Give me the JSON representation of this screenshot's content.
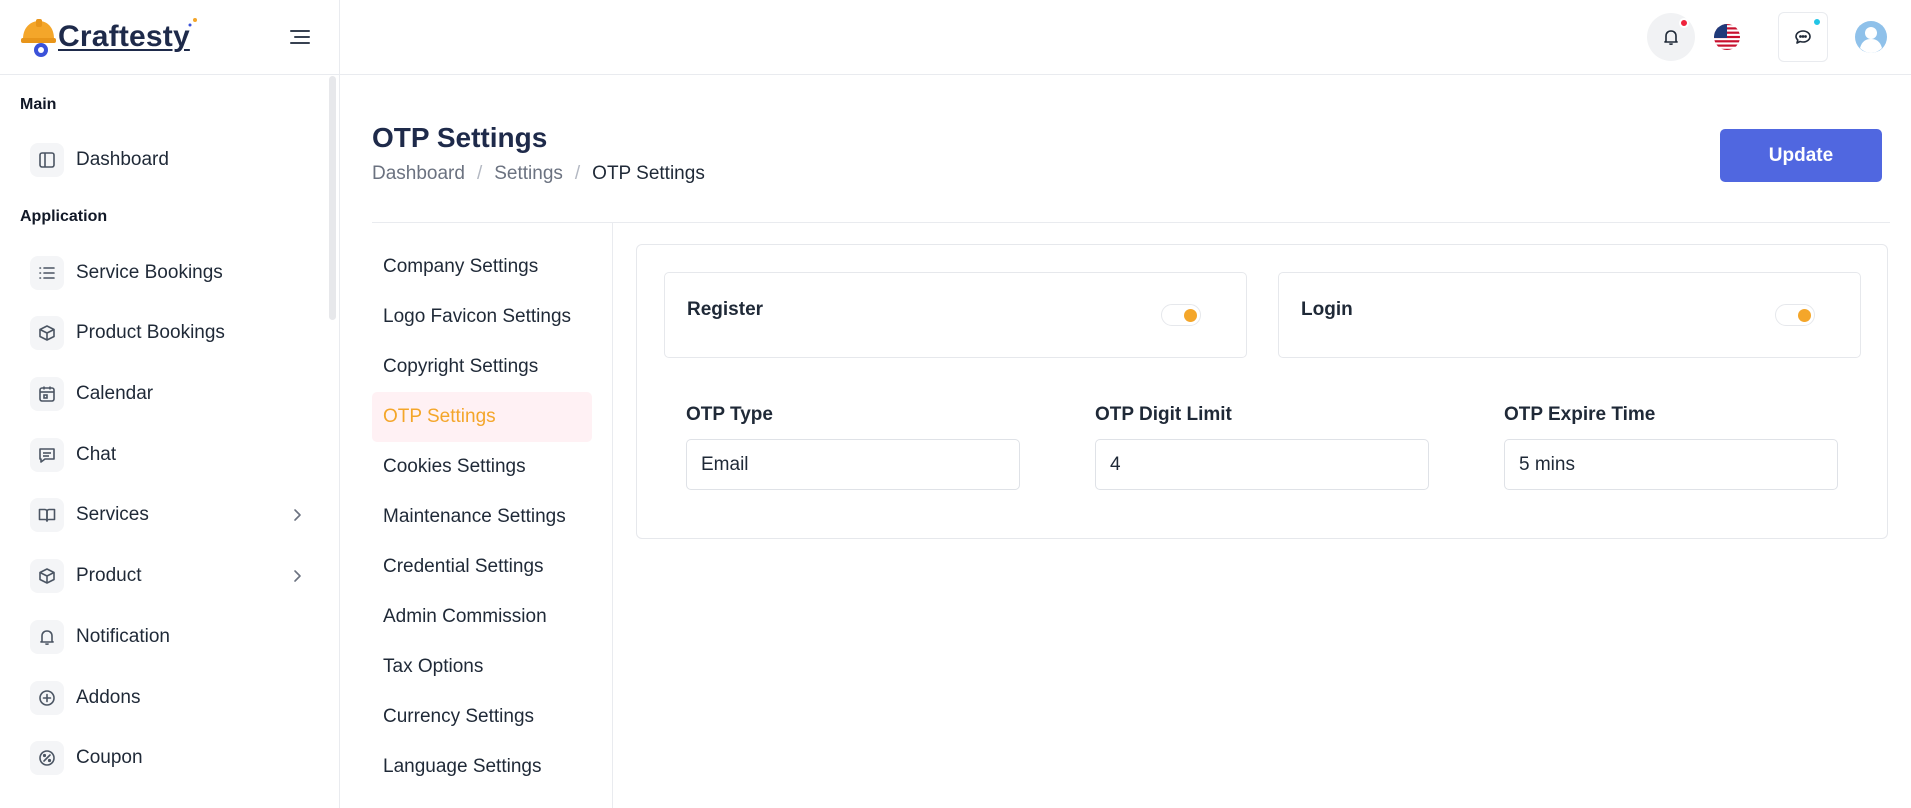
{
  "brand": {
    "name": "Craftesty"
  },
  "sidebar": {
    "sections": [
      {
        "title": "Main"
      },
      {
        "title": "Application"
      }
    ],
    "items": [
      {
        "label": "Dashboard",
        "icon": "layout-icon"
      },
      {
        "label": "Service Bookings",
        "icon": "list-icon"
      },
      {
        "label": "Product Bookings",
        "icon": "box-icon"
      },
      {
        "label": "Calendar",
        "icon": "calendar-icon"
      },
      {
        "label": "Chat",
        "icon": "chat-icon"
      },
      {
        "label": "Services",
        "icon": "book-icon",
        "has_children": true
      },
      {
        "label": "Product",
        "icon": "box-icon",
        "has_children": true
      },
      {
        "label": "Notification",
        "icon": "bell-icon"
      },
      {
        "label": "Addons",
        "icon": "plus-circle-icon"
      },
      {
        "label": "Coupon",
        "icon": "coupon-icon"
      }
    ]
  },
  "topbar": {
    "icons": [
      "bell-icon",
      "us-flag-icon",
      "chat-icon",
      "user-avatar-icon"
    ],
    "bell_dot_color": "#ef233c",
    "chat_dot_color": "#22c5e6"
  },
  "page": {
    "title": "OTP Settings",
    "breadcrumb": [
      "Dashboard",
      "Settings",
      "OTP Settings"
    ],
    "update_label": "Update"
  },
  "settings_menu": {
    "items": [
      "Company Settings",
      "Logo Favicon Settings",
      "Copyright Settings",
      "OTP Settings",
      "Cookies Settings",
      "Maintenance Settings",
      "Credential Settings",
      "Admin Commission",
      "Tax Options",
      "Currency Settings",
      "Language Settings"
    ],
    "active": "OTP Settings"
  },
  "otp": {
    "toggles": [
      {
        "label": "Register",
        "on": true
      },
      {
        "label": "Login",
        "on": true
      }
    ],
    "fields": [
      {
        "label": "OTP Type",
        "value": "Email"
      },
      {
        "label": "OTP Digit Limit",
        "value": "4"
      },
      {
        "label": "OTP Expire Time",
        "value": "5 mins"
      }
    ]
  },
  "colors": {
    "accent": "#5067e0",
    "active_menu_text": "#f4a62a",
    "active_menu_bg": "#fff1f4",
    "toggle_knob": "#f4a62a"
  }
}
